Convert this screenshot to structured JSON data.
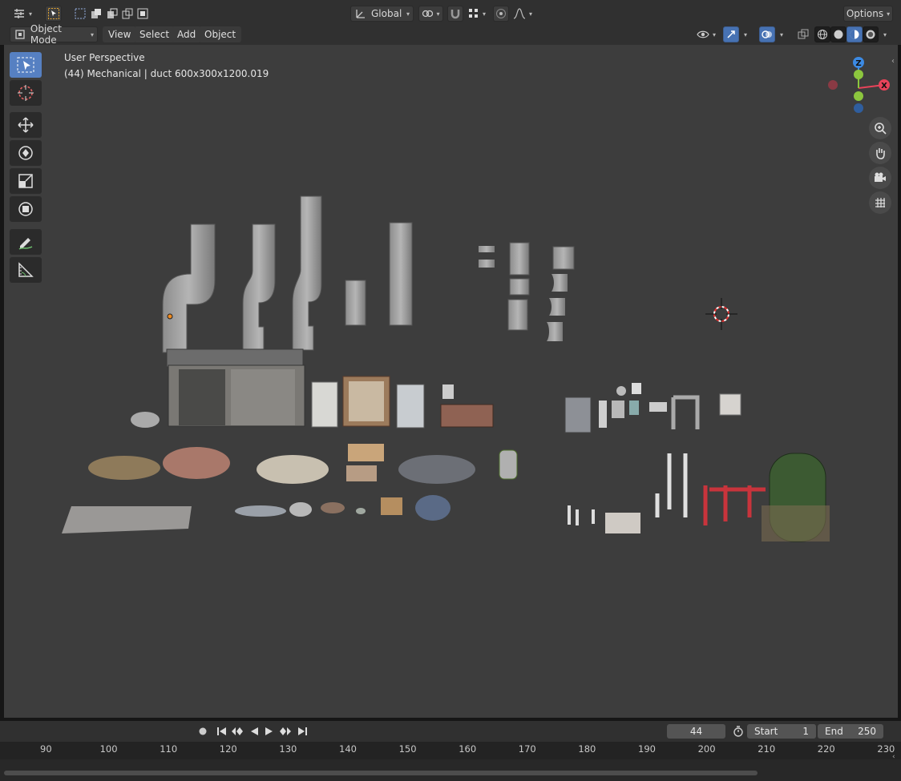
{
  "header": {
    "transform_orientation": "Global",
    "options_label": "Options"
  },
  "menubar": {
    "mode": "Object Mode",
    "menus": [
      "View",
      "Select",
      "Add",
      "Object"
    ]
  },
  "viewport": {
    "view_name": "User Perspective",
    "object_info": "(44) Mechanical | duct 600x300x1200.019",
    "gizmo": {
      "z": "Z",
      "x": "X"
    }
  },
  "toolbar": {
    "tools": [
      "select-box",
      "cursor",
      "move",
      "rotate",
      "scale",
      "transform",
      "annotate",
      "measure"
    ]
  },
  "timeline": {
    "current_frame": "44",
    "start_label": "Start",
    "start_value": "1",
    "end_label": "End",
    "end_value": "250",
    "ticks": [
      "90",
      "100",
      "110",
      "120",
      "130",
      "140",
      "150",
      "160",
      "170",
      "180",
      "190",
      "200",
      "210",
      "220",
      "230"
    ]
  },
  "colors": {
    "accent": "#4772b3",
    "axis_x": "#e8435a",
    "axis_y": "#8cc63e",
    "axis_z": "#3c8ae3"
  }
}
